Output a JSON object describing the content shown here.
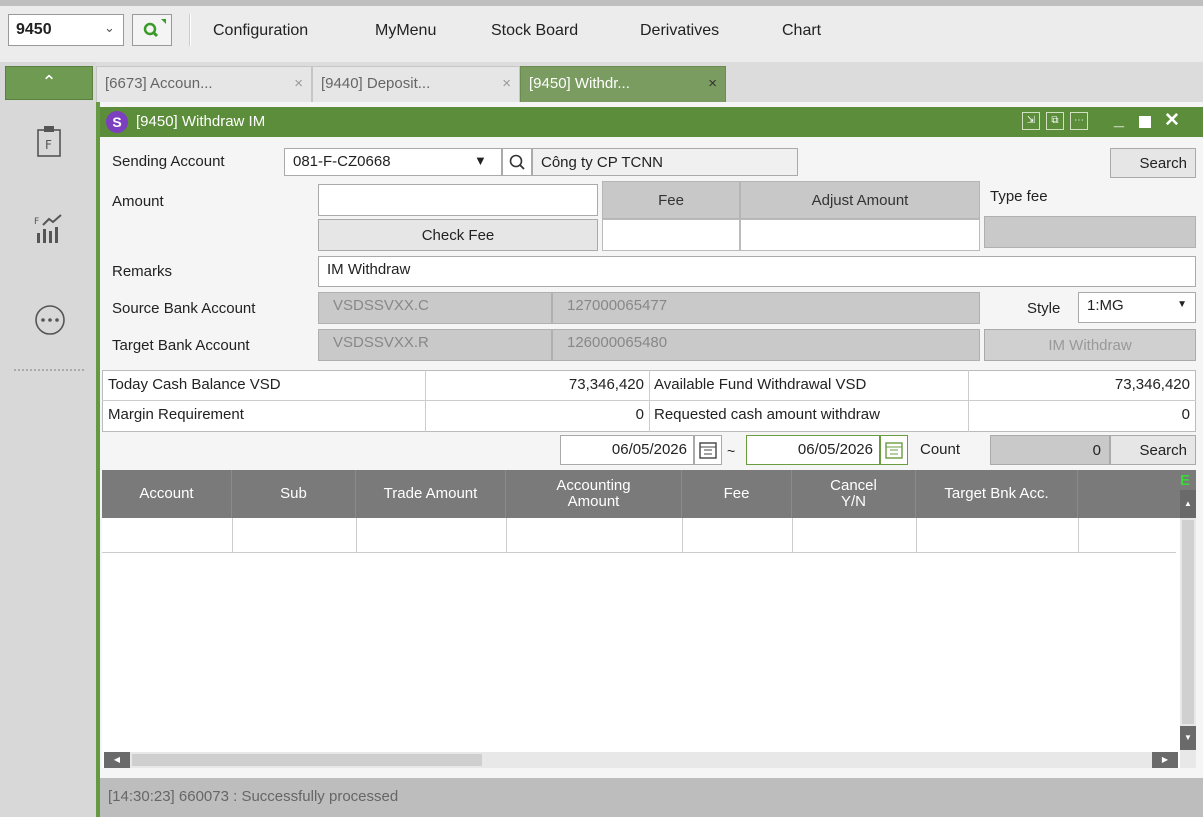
{
  "top": {
    "code": "9450",
    "menu": [
      "Configuration",
      "MyMenu",
      "Stock Board",
      "Derivatives",
      "Chart"
    ]
  },
  "tabs": [
    {
      "label": "[6673] Accoun...",
      "active": false
    },
    {
      "label": "[9440] Deposit...",
      "active": false
    },
    {
      "label": "[9450] Withdr...",
      "active": true
    }
  ],
  "window": {
    "title": "[9450] Withdraw IM"
  },
  "form": {
    "sending_account_label": "Sending Account",
    "sending_account_value": "081-F-CZ0668",
    "account_name": "Công ty CP TCNN",
    "search_label": "Search",
    "amount_label": "Amount",
    "amount_value": "",
    "fee_header": "Fee",
    "adjust_header": "Adjust Amount",
    "type_fee_label": "Type fee",
    "check_fee_label": "Check Fee",
    "remarks_label": "Remarks",
    "remarks_value": "IM Withdraw",
    "source_bank_label": "Source Bank Account",
    "source_bank_code": "VSDSSVXX.C",
    "source_bank_number": "127000065477",
    "style_label": "Style",
    "style_value": "1:MG",
    "target_bank_label": "Target Bank Account",
    "target_bank_code": "VSDSSVXX.R",
    "target_bank_number": "126000065480",
    "im_withdraw_label": "IM Withdraw"
  },
  "summary": {
    "today_cash_label": "Today Cash Balance VSD",
    "today_cash_value": "73,346,420",
    "avail_label": "Available Fund Withdrawal VSD",
    "avail_value": "73,346,420",
    "margin_label": "Margin Requirement",
    "margin_value": "0",
    "requested_label": "Requested cash amount withdraw",
    "requested_value": "0"
  },
  "filter": {
    "date_from": "06/05/2026",
    "tilde": "~",
    "date_to": "06/05/2026",
    "count_label": "Count",
    "count_value": "0",
    "search_label": "Search"
  },
  "grid": {
    "columns": [
      "Account",
      "Sub",
      "Trade Amount",
      "Accounting Amount",
      "Fee",
      "Cancel Y/N",
      "Target Bnk Acc."
    ],
    "excel_marker": "E",
    "rows": []
  },
  "status": {
    "text": "[14:30:23] 660073 : Successfully processed"
  },
  "colors": {
    "accent_green": "#5c8d3a",
    "header_gray": "#7a7a7a"
  }
}
